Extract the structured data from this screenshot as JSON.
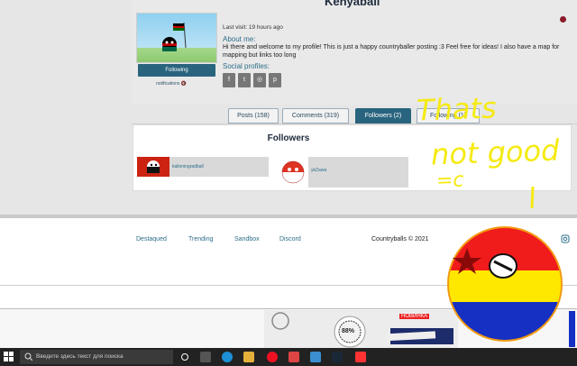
{
  "profile": {
    "username": "Kenyaball",
    "last_visit": "Last visit: 19 hours ago",
    "about_heading": "About me:",
    "about_text": "Hi there and welcome to my profile! This is just a happy countryballer posting :3 Feel free for ideas! I also have a map for mapping but links too long",
    "social_heading": "Social profiles:",
    "follow_button": "Following",
    "notifications": "notifications 🔇",
    "social_icons": [
      "facebook-icon",
      "twitter-icon",
      "instagram-icon",
      "pinterest-icon"
    ],
    "social_glyphs": [
      "f",
      "t",
      "◎",
      "p"
    ]
  },
  "tabs": [
    {
      "label": "Posts (158)",
      "active": false
    },
    {
      "label": "Comments (319)",
      "active": false
    },
    {
      "label": "Followers (2)",
      "active": true
    },
    {
      "label": "Following (1)",
      "active": false
    }
  ],
  "followers": {
    "title": "Followers",
    "items": [
      {
        "name": "kalinningradball"
      },
      {
        "name": "ykZawa"
      }
    ]
  },
  "footer": {
    "links": [
      "Destaqued",
      "Trending",
      "Sandbox",
      "Discord"
    ],
    "copyright": "Countryballs © 2021"
  },
  "annotation": {
    "line1": "Thats",
    "line2": "not good",
    "line3": "=c"
  },
  "ad": {
    "badge": "НОВИНКА",
    "percent": "88%"
  },
  "taskbar": {
    "search_placeholder": "Введите здесь текст для поиска"
  },
  "colors": {
    "accent": "#29647e",
    "annotation": "#f5ea12"
  }
}
